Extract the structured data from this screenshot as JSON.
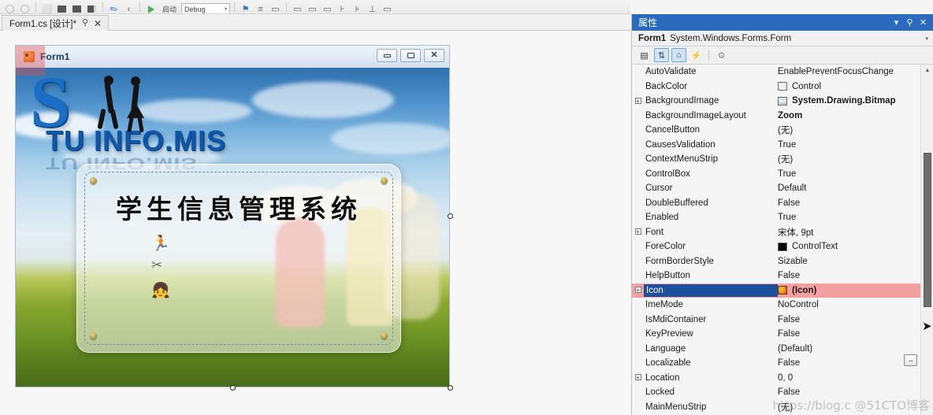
{
  "toolbar": {
    "icons": [
      "undo-icon",
      "redo-icon",
      "new-item-icon",
      "cut-icon",
      "copy-icon",
      "paste-icon",
      "format-icon",
      "navigate-back-icon"
    ],
    "run_label": "启动",
    "config_value": "Debug",
    "right_icons": [
      "find-icon",
      "comment-icon",
      "uncomment-icon",
      "indent-icon",
      "outdent-icon",
      "bookmark-icon",
      "align-icon"
    ]
  },
  "document_tab": {
    "label": "Form1.cs [设计]*",
    "pin_icon": "pin-icon",
    "close_icon": "close-icon"
  },
  "form": {
    "title": "Form1",
    "icon_name": "form-app-icon",
    "caption_buttons": [
      {
        "name": "minimize-button",
        "glyph": "min"
      },
      {
        "name": "maximize-button",
        "glyph": "max"
      },
      {
        "name": "close-button",
        "glyph": "✕"
      }
    ],
    "logo_initial": "S",
    "logo_text": "TU INFO.MIS",
    "panel_title": "学生信息管理系统",
    "mini_icons": [
      "running-person-icon",
      "scissors-icon",
      "child-avatar-icon"
    ]
  },
  "properties": {
    "title": "属性",
    "title_buttons": [
      {
        "name": "panel-dropdown-icon",
        "glyph": "▾"
      },
      {
        "name": "pin-icon",
        "glyph": "⚲"
      },
      {
        "name": "close-icon",
        "glyph": "✕"
      }
    ],
    "object_name": "Form1",
    "object_type": "System.Windows.Forms.Form",
    "object_dropdown_glyph": "▾",
    "toolbar_buttons": [
      {
        "name": "categorized-button",
        "glyph": "▤",
        "active": false
      },
      {
        "name": "alphabetical-button",
        "glyph": "↓",
        "active": true
      },
      {
        "name": "properties-button",
        "glyph": "⌂",
        "active": true
      },
      {
        "name": "events-button",
        "glyph": "⚡",
        "active": false
      },
      {
        "name": "property-pages-button",
        "glyph": "⚙",
        "active": false
      }
    ],
    "ellipsis_button_label": "...",
    "rows": [
      {
        "name": "AutoValidate",
        "value": "EnablePreventFocusChange",
        "expand": false,
        "bold": false,
        "swatch": null
      },
      {
        "name": "BackColor",
        "value": "Control",
        "expand": false,
        "bold": false,
        "swatch": "white"
      },
      {
        "name": "BackgroundImage",
        "value": "System.Drawing.Bitmap",
        "expand": true,
        "bold": true,
        "swatch": "bmp"
      },
      {
        "name": "BackgroundImageLayout",
        "value": "Zoom",
        "expand": false,
        "bold": true,
        "swatch": null
      },
      {
        "name": "CancelButton",
        "value": "(无)",
        "expand": false,
        "bold": false,
        "swatch": null
      },
      {
        "name": "CausesValidation",
        "value": "True",
        "expand": false,
        "bold": false,
        "swatch": null
      },
      {
        "name": "ContextMenuStrip",
        "value": "(无)",
        "expand": false,
        "bold": false,
        "swatch": null
      },
      {
        "name": "ControlBox",
        "value": "True",
        "expand": false,
        "bold": false,
        "swatch": null
      },
      {
        "name": "Cursor",
        "value": "Default",
        "expand": false,
        "bold": false,
        "swatch": null
      },
      {
        "name": "DoubleBuffered",
        "value": "False",
        "expand": false,
        "bold": false,
        "swatch": null
      },
      {
        "name": "Enabled",
        "value": "True",
        "expand": false,
        "bold": false,
        "swatch": null
      },
      {
        "name": "Font",
        "value": "宋体, 9pt",
        "expand": true,
        "bold": false,
        "swatch": null
      },
      {
        "name": "ForeColor",
        "value": "ControlText",
        "expand": false,
        "bold": false,
        "swatch": "black"
      },
      {
        "name": "FormBorderStyle",
        "value": "Sizable",
        "expand": false,
        "bold": false,
        "swatch": null
      },
      {
        "name": "HelpButton",
        "value": "False",
        "expand": false,
        "bold": false,
        "swatch": null
      },
      {
        "name": "Icon",
        "value": "(Icon)",
        "expand": true,
        "bold": true,
        "swatch": "icoimg",
        "selected": true
      },
      {
        "name": "ImeMode",
        "value": "NoControl",
        "expand": false,
        "bold": false,
        "swatch": null
      },
      {
        "name": "IsMdiContainer",
        "value": "False",
        "expand": false,
        "bold": false,
        "swatch": null
      },
      {
        "name": "KeyPreview",
        "value": "False",
        "expand": false,
        "bold": false,
        "swatch": null
      },
      {
        "name": "Language",
        "value": "(Default)",
        "expand": false,
        "bold": false,
        "swatch": null
      },
      {
        "name": "Localizable",
        "value": "False",
        "expand": false,
        "bold": false,
        "swatch": null
      },
      {
        "name": "Location",
        "value": "0, 0",
        "expand": true,
        "bold": false,
        "swatch": null
      },
      {
        "name": "Locked",
        "value": "False",
        "expand": false,
        "bold": false,
        "swatch": null
      },
      {
        "name": "MainMenuStrip",
        "value": "(无)",
        "expand": false,
        "bold": false,
        "swatch": null
      }
    ]
  },
  "watermark": "https://blog.c @51CTO博客"
}
